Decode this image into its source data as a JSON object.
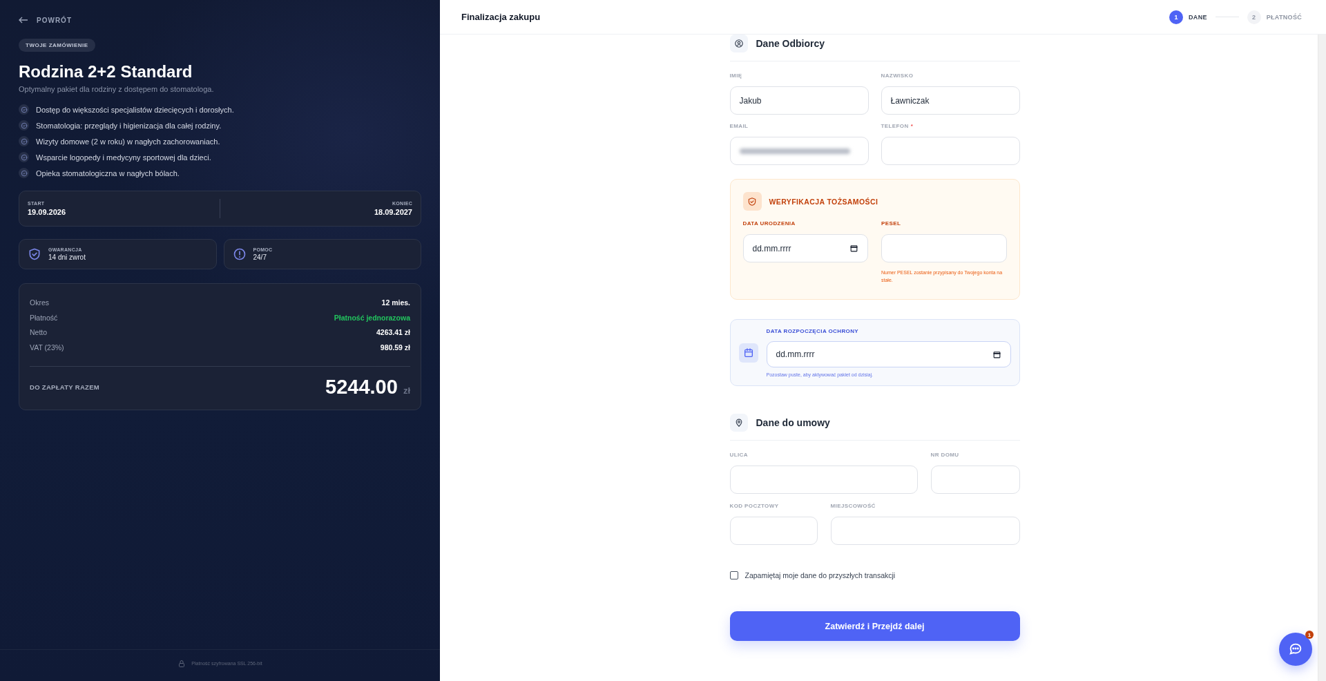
{
  "summary_panel": {
    "back_link": "POWRÓT",
    "badge": "TWOJE ZAMÓWIENIE",
    "title": "Rodzina 2+2 Standard",
    "subtitle": "Optymalny pakiet dla rodziny z dostępem do stomatologa.",
    "features": [
      "Dostęp do większości specjalistów dziecięcych i dorosłych.",
      "Stomatologia: przeglądy i higienizacja dla całej rodziny.",
      "Wizyty domowe (2 w roku) w nagłych zachorowaniach.",
      "Wsparcie logopedy i medycyny sportowej dla dzieci.",
      "Opieka stomatologiczna w nagłych bólach."
    ],
    "period": {
      "start_label": "START",
      "start": "19.09.2026",
      "end_label": "KONIEC",
      "end": "18.09.2027"
    },
    "info_cards": [
      {
        "kind": "shield",
        "label": "GWARANCJA",
        "value": "14 dni zwrot"
      },
      {
        "kind": "alert",
        "label": "POMOC",
        "value": "24/7"
      }
    ],
    "price_rows": [
      {
        "label": "Okres",
        "value": "12 mies.",
        "highlight": false
      },
      {
        "label": "Płatność",
        "value": "Płatność jednorazowa",
        "highlight": true
      },
      {
        "label": "Netto",
        "value": "4263.41 zł",
        "highlight": false
      },
      {
        "label": "VAT (23%)",
        "value": "980.59 zł",
        "highlight": false
      }
    ],
    "total_label": "DO ZAPŁATY RAZEM",
    "total": "5244.00",
    "currency": "zł",
    "footer": "Płatność szyfrowana SSL 256-bit"
  },
  "header": {
    "title": "Finalizacja zakupu",
    "steps": [
      {
        "number": "1",
        "label": "DANE",
        "selected": true
      },
      {
        "number": "2",
        "label": "PŁATNOŚĆ",
        "selected": false
      }
    ]
  },
  "form": {
    "recipient": {
      "title": "Dane Odbiorcy",
      "fields": [
        {
          "label": "IMIĘ",
          "value": "Jakub"
        },
        {
          "label": "NAZWISKO",
          "value": "Ławniczak"
        },
        {
          "label": "EMAIL",
          "redacted": true
        },
        {
          "label": "TELEFON",
          "required_mark": "*"
        }
      ]
    },
    "verification": {
      "title": "WERYFIKACJA TOŻSAMOŚCI",
      "birth_label": "DATA URODZENIA",
      "birth_placeholder": "dd.mm.rrrr",
      "pesel_label": "PESEL",
      "pesel_hint": "Numer PESEL zostanie przypisany do Twojego konta na stałe."
    },
    "start_date": {
      "label": "DATA ROZPOCZĘCIA OCHRONY",
      "placeholder": "dd.mm.rrrr",
      "hint": "Pozostaw puste, aby aktywować pakiet od dzisiaj."
    },
    "contract": {
      "title": "Dane do umowy",
      "fields": [
        {
          "label": "ULICA"
        },
        {
          "label": "NR DOMU"
        },
        {
          "label": "KOD POCZTOWY"
        },
        {
          "label": "MIEJSCOWOŚĆ"
        }
      ]
    },
    "remember": {
      "label": "Zapamiętaj moje dane do przyszłych transakcji",
      "checked": false
    },
    "submit": "Zatwierdź i Przejdź dalej"
  },
  "chat": {
    "badge": "1"
  }
}
